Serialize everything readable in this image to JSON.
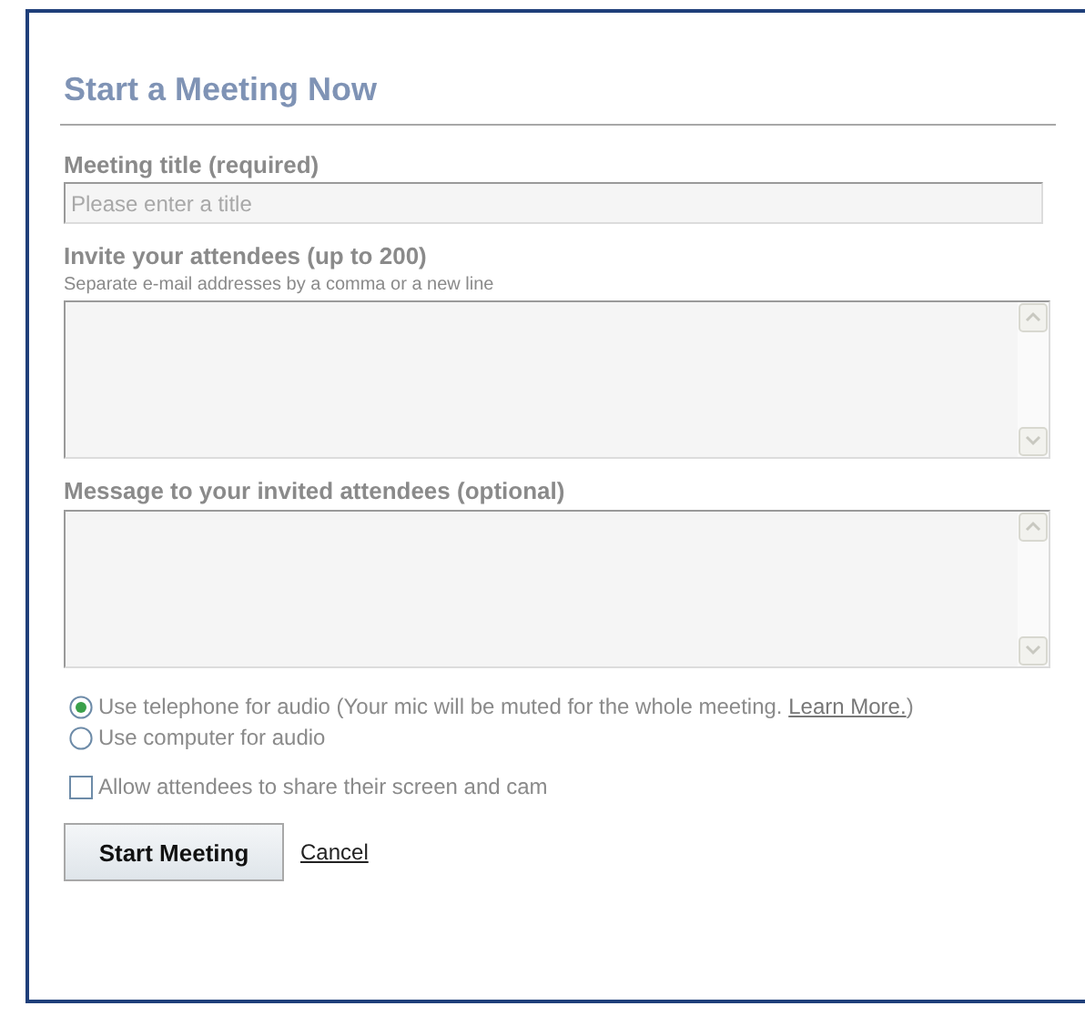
{
  "dialog": {
    "title": "Start a Meeting Now"
  },
  "fields": [
    {
      "kind": "input",
      "label": "Meeting title (required)",
      "placeholder": "Please enter a title"
    },
    {
      "kind": "textarea",
      "label": "Invite your attendees (up to 200)",
      "hint": "Separate e-mail addresses by a comma or a new line"
    },
    {
      "kind": "textarea",
      "label": "Message to your invited attendees (optional)"
    }
  ],
  "audio_options": [
    {
      "label": "Use telephone for audio (Your mic will be muted for the whole meeting. ",
      "link": "Learn More.",
      "after": ")",
      "selected": true
    },
    {
      "label": "Use computer for audio",
      "selected": false
    }
  ],
  "share_option": {
    "label": "Allow attendees to share their screen and cam",
    "checked": false
  },
  "buttons": {
    "primary": "Start Meeting",
    "cancel": "Cancel"
  }
}
